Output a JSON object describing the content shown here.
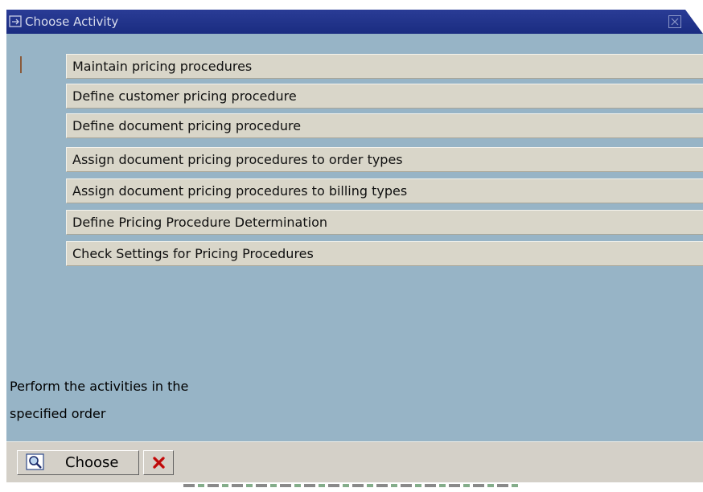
{
  "window": {
    "title": "Choose Activity"
  },
  "activities": [
    {
      "label": "Maintain pricing procedures"
    },
    {
      "label": "Define customer pricing procedure"
    },
    {
      "label": "Define document pricing procedure"
    },
    {
      "label": "Assign document pricing procedures to order types"
    },
    {
      "label": "Assign document pricing procedures to billing types"
    },
    {
      "label": "Define Pricing Procedure Determination"
    },
    {
      "label": "Check Settings for Pricing Procedures"
    }
  ],
  "instruction": {
    "line1": "Perform the activities in the",
    "line2": "specified order"
  },
  "toolbar": {
    "choose_label": "Choose",
    "choose_icon": "magnifier-icon",
    "cancel_icon": "red-x-icon"
  },
  "colors": {
    "titlebar": "#1f3288",
    "dialog_background": "#97b4c6",
    "item_background": "#d9d6c9",
    "toolbar_background": "#d4d0c8",
    "cancel_red": "#d01010"
  }
}
